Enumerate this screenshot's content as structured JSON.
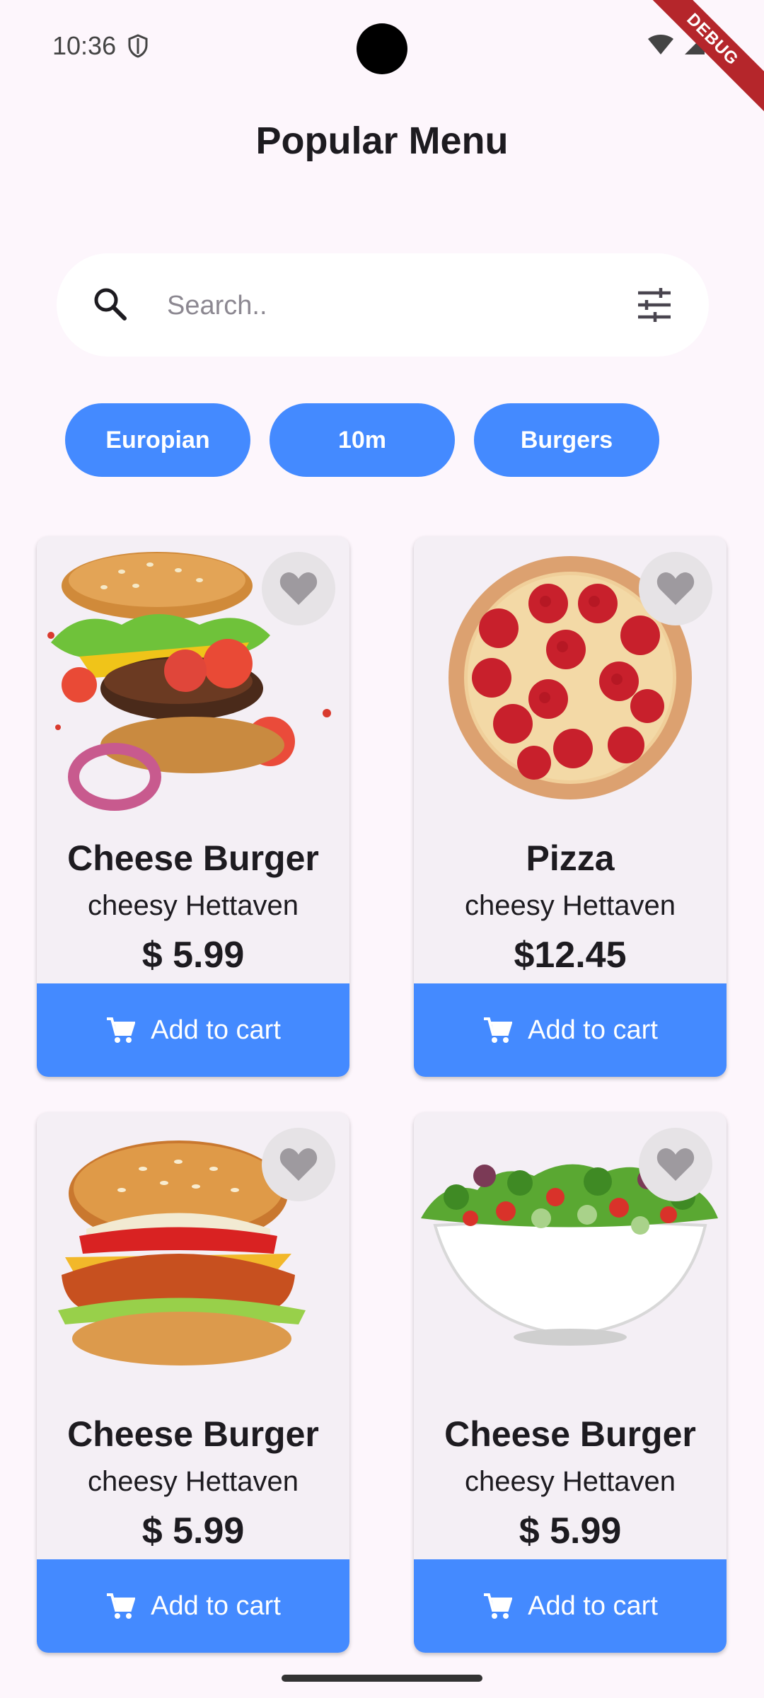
{
  "status_bar": {
    "time": "10:36",
    "debug_label": "DEBUG"
  },
  "title": "Popular Menu",
  "search": {
    "placeholder": "Search..",
    "value": ""
  },
  "chips": [
    {
      "label": "Europian"
    },
    {
      "label": "10m"
    },
    {
      "label": "Burgers"
    }
  ],
  "items": [
    {
      "name": "Cheese Burger",
      "subtitle": "cheesy Hettaven",
      "price": "$ 5.99",
      "button": "Add to cart",
      "image": "burger-image"
    },
    {
      "name": "Pizza",
      "subtitle": "cheesy Hettaven",
      "price": "$12.45",
      "button": "Add to cart",
      "image": "pizza-image"
    },
    {
      "name": "Cheese Burger",
      "subtitle": "cheesy Hettaven",
      "price": "$ 5.99",
      "button": "Add to cart",
      "image": "chicken-burger-image"
    },
    {
      "name": "Cheese Burger",
      "subtitle": "cheesy Hettaven",
      "price": "$ 5.99",
      "button": "Add to cart",
      "image": "salad-image"
    }
  ],
  "colors": {
    "accent": "#448aff",
    "background": "#fdf6fc",
    "card": "#f4eff5"
  }
}
